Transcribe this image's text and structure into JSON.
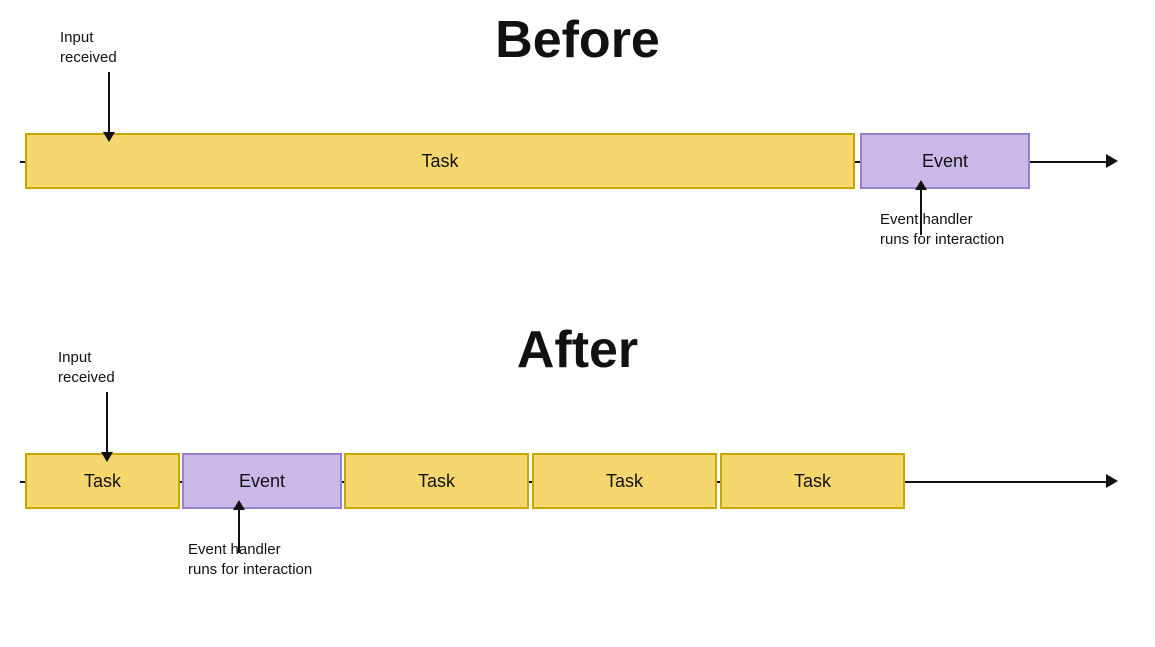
{
  "before": {
    "title": "Before",
    "input_label": "Input\nreceived",
    "task_label": "Task",
    "event_label": "Event",
    "handler_label": "Event handler\nruns for interaction"
  },
  "after": {
    "title": "After",
    "input_label": "Input\nreceived",
    "task_label": "Task",
    "event_label": "Event",
    "handler_label": "Event handler\nruns for interaction",
    "task2_label": "Task",
    "task3_label": "Task",
    "task4_label": "Task"
  }
}
